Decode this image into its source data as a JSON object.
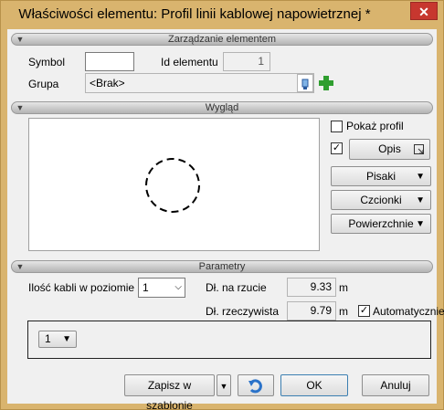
{
  "window": {
    "title": "Właściwości elementu: Profil linii kablowej napowietrznej *"
  },
  "sections": {
    "management": "Zarządzanie elementem",
    "appearance": "Wygląd",
    "parameters": "Parametry"
  },
  "management": {
    "symbol_label": "Symbol",
    "symbol_value": "",
    "id_label": "Id elementu",
    "id_value": "1",
    "group_label": "Grupa",
    "group_value": "<Brak>"
  },
  "appearance": {
    "show_profile_label": "Pokaż profil",
    "show_profile_checked": false,
    "opis_checked": true,
    "opis_label": "Opis",
    "pens_label": "Pisaki",
    "fonts_label": "Czcionki",
    "surfaces_label": "Powierzchnie"
  },
  "parameters": {
    "cables_label": "Ilość kabli w poziomie",
    "cables_value": "1",
    "projection_label": "Dł. na rzucie",
    "projection_value": "9.33",
    "projection_unit": "m",
    "real_label": "Dł. rzeczywista",
    "real_value": "9.79",
    "real_unit": "m",
    "auto_label": "Automatycznie",
    "auto_checked": true,
    "level_value": "1"
  },
  "footer": {
    "save_template_label": "Zapisz w szablonie",
    "ok_label": "OK",
    "cancel_label": "Anuluj"
  },
  "colors": {
    "frame": "#d9b46e",
    "close": "#c7372f",
    "add_green": "#2f9e2f",
    "undo_blue": "#2a72c9"
  }
}
